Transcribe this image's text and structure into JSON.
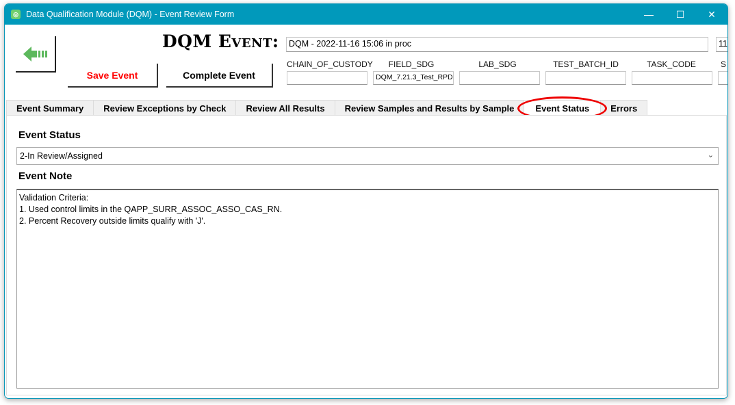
{
  "window": {
    "title": "Data Qualification Module (DQM) - Event Review Form",
    "controls": {
      "minimize": "—",
      "maximize": "☐",
      "close": "✕"
    }
  },
  "header": {
    "title": "DQM Event:",
    "event_name": "DQM - 2022-11-16 15:06 in proc",
    "date_partial": "11/",
    "save_label": "Save Event",
    "complete_label": "Complete Event",
    "back_icon": "green-arrow-left-icon",
    "fields": [
      {
        "label": "CHAIN_OF_CUSTODY",
        "value": ""
      },
      {
        "label": "FIELD_SDG",
        "value": "DQM_7.21.3_Test_RPD"
      },
      {
        "label": "LAB_SDG",
        "value": ""
      },
      {
        "label": "TEST_BATCH_ID",
        "value": ""
      },
      {
        "label": "TASK_CODE",
        "value": ""
      },
      {
        "label": "S",
        "value": ""
      }
    ]
  },
  "tabs": [
    {
      "label": "Event Summary"
    },
    {
      "label": "Review Exceptions by Check"
    },
    {
      "label": "Review All Results"
    },
    {
      "label": "Review Samples and Results by Sample"
    },
    {
      "label": "Event Status",
      "active": true
    },
    {
      "label": "Errors"
    }
  ],
  "main": {
    "status_label": "Event Status",
    "status_value": "2-In Review/Assigned",
    "note_label": "Event Note",
    "note_text": "Validation Criteria:\n1. Used control limits in the QAPP_SURR_ASSOC_ASSO_CAS_RN.\n2. Percent Recovery outside limits qualify with 'J'."
  },
  "colors": {
    "titlebar": "#0199bb",
    "save": "#ff0000",
    "highlight_ring": "#e00000",
    "back_arrow": "#5cb85c"
  }
}
